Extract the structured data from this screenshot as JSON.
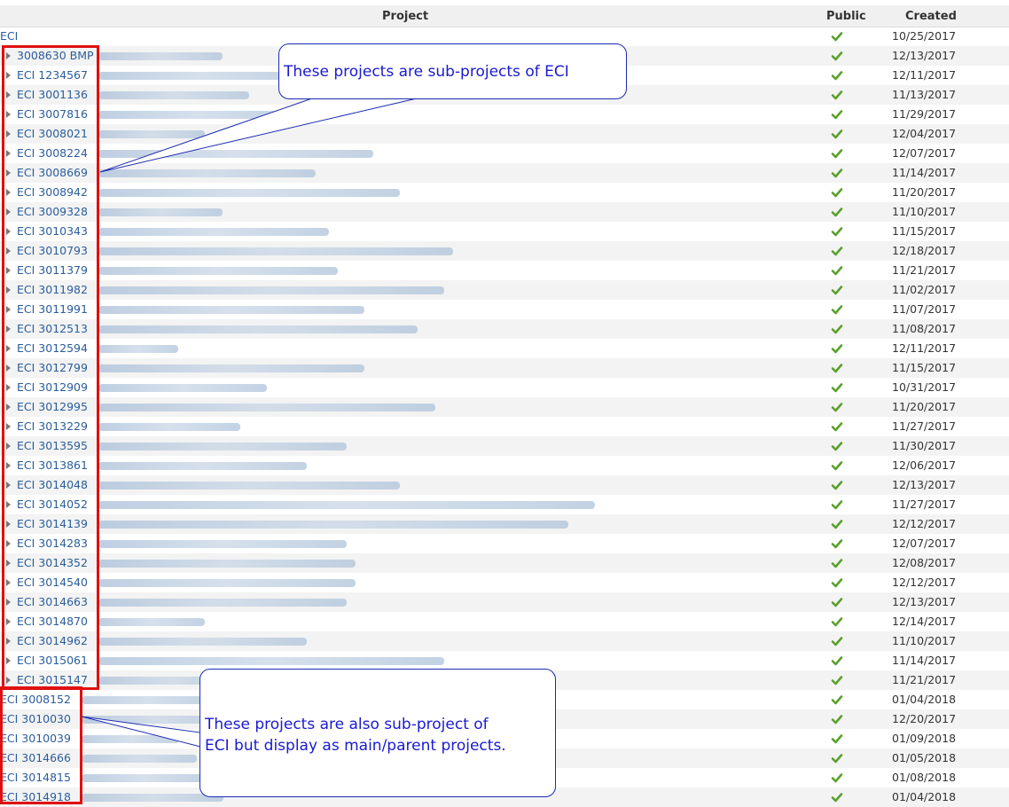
{
  "columns": {
    "project": "Project",
    "public": "Public",
    "created": "Created"
  },
  "accent": {
    "link": "#2a5d9c",
    "check": "#5aa02c",
    "highlight": "#e01010",
    "callout_text": "#1a1ad0"
  },
  "rows": [
    {
      "code": "ECI",
      "level": "top",
      "created": "10/25/2017",
      "public_icon": "check-icon"
    },
    {
      "code": "3008630 BMP",
      "level": "child",
      "created": "12/13/2017",
      "public_icon": "check-icon"
    },
    {
      "code": "ECI 1234567",
      "level": "child",
      "created": "12/11/2017",
      "public_icon": "check-icon"
    },
    {
      "code": "ECI 3001136",
      "level": "child",
      "created": "11/13/2017",
      "public_icon": "check-icon"
    },
    {
      "code": "ECI 3007816",
      "level": "child",
      "created": "11/29/2017",
      "public_icon": "check-icon"
    },
    {
      "code": "ECI 3008021",
      "level": "child",
      "created": "12/04/2017",
      "public_icon": "check-icon"
    },
    {
      "code": "ECI 3008224",
      "level": "child",
      "created": "12/07/2017",
      "public_icon": "check-icon"
    },
    {
      "code": "ECI 3008669",
      "level": "child",
      "created": "11/14/2017",
      "public_icon": "check-icon"
    },
    {
      "code": "ECI 3008942",
      "level": "child",
      "created": "11/20/2017",
      "public_icon": "check-icon"
    },
    {
      "code": "ECI 3009328",
      "level": "child",
      "created": "11/10/2017",
      "public_icon": "check-icon"
    },
    {
      "code": "ECI 3010343",
      "level": "child",
      "created": "11/15/2017",
      "public_icon": "check-icon"
    },
    {
      "code": "ECI 3010793",
      "level": "child",
      "created": "12/18/2017",
      "public_icon": "check-icon"
    },
    {
      "code": "ECI 3011379",
      "level": "child",
      "created": "11/21/2017",
      "public_icon": "check-icon"
    },
    {
      "code": "ECI 3011982",
      "level": "child",
      "created": "11/02/2017",
      "public_icon": "check-icon"
    },
    {
      "code": "ECI 3011991",
      "level": "child",
      "created": "11/07/2017",
      "public_icon": "check-icon"
    },
    {
      "code": "ECI 3012513",
      "level": "child",
      "created": "11/08/2017",
      "public_icon": "check-icon"
    },
    {
      "code": "ECI 3012594",
      "level": "child",
      "created": "12/11/2017",
      "public_icon": "check-icon"
    },
    {
      "code": "ECI 3012799",
      "level": "child",
      "created": "11/15/2017",
      "public_icon": "check-icon"
    },
    {
      "code": "ECI 3012909",
      "level": "child",
      "created": "10/31/2017",
      "public_icon": "check-icon"
    },
    {
      "code": "ECI 3012995",
      "level": "child",
      "created": "11/20/2017",
      "public_icon": "check-icon"
    },
    {
      "code": "ECI 3013229",
      "level": "child",
      "created": "11/27/2017",
      "public_icon": "check-icon"
    },
    {
      "code": "ECI 3013595",
      "level": "child",
      "created": "11/30/2017",
      "public_icon": "check-icon"
    },
    {
      "code": "ECI 3013861",
      "level": "child",
      "created": "12/06/2017",
      "public_icon": "check-icon"
    },
    {
      "code": "ECI 3014048",
      "level": "child",
      "created": "12/13/2017",
      "public_icon": "check-icon"
    },
    {
      "code": "ECI 3014052",
      "level": "child",
      "created": "11/27/2017",
      "public_icon": "check-icon"
    },
    {
      "code": "ECI 3014139",
      "level": "child",
      "created": "12/12/2017",
      "public_icon": "check-icon"
    },
    {
      "code": "ECI 3014283",
      "level": "child",
      "created": "12/07/2017",
      "public_icon": "check-icon"
    },
    {
      "code": "ECI 3014352",
      "level": "child",
      "created": "12/08/2017",
      "public_icon": "check-icon"
    },
    {
      "code": "ECI 3014540",
      "level": "child",
      "created": "12/12/2017",
      "public_icon": "check-icon"
    },
    {
      "code": "ECI 3014663",
      "level": "child",
      "created": "12/13/2017",
      "public_icon": "check-icon"
    },
    {
      "code": "ECI 3014870",
      "level": "child",
      "created": "12/14/2017",
      "public_icon": "check-icon"
    },
    {
      "code": "ECI 3014962",
      "level": "child",
      "created": "11/10/2017",
      "public_icon": "check-icon"
    },
    {
      "code": "ECI 3015061",
      "level": "child",
      "created": "11/14/2017",
      "public_icon": "check-icon"
    },
    {
      "code": "ECI 3015147",
      "level": "child",
      "created": "11/21/2017",
      "public_icon": "check-icon"
    },
    {
      "code": "ECI 3008152",
      "level": "top",
      "created": "01/04/2018",
      "public_icon": "check-icon"
    },
    {
      "code": "ECI 3010030",
      "level": "top",
      "created": "12/20/2017",
      "public_icon": "check-icon"
    },
    {
      "code": "ECI 3010039",
      "level": "top",
      "created": "01/09/2018",
      "public_icon": "check-icon"
    },
    {
      "code": "ECI 3014666",
      "level": "top",
      "created": "01/05/2018",
      "public_icon": "check-icon"
    },
    {
      "code": "ECI 3014815",
      "level": "top",
      "created": "01/08/2018",
      "public_icon": "check-icon"
    },
    {
      "code": "ECI 3014918",
      "level": "top",
      "created": "01/04/2018",
      "public_icon": "check-icon"
    }
  ],
  "callouts": {
    "subprojects": "These projects are sub-projects of ECI",
    "parents_line1": "These projects are also sub-project of",
    "parents_line2": "ECI but display as main/parent projects."
  }
}
